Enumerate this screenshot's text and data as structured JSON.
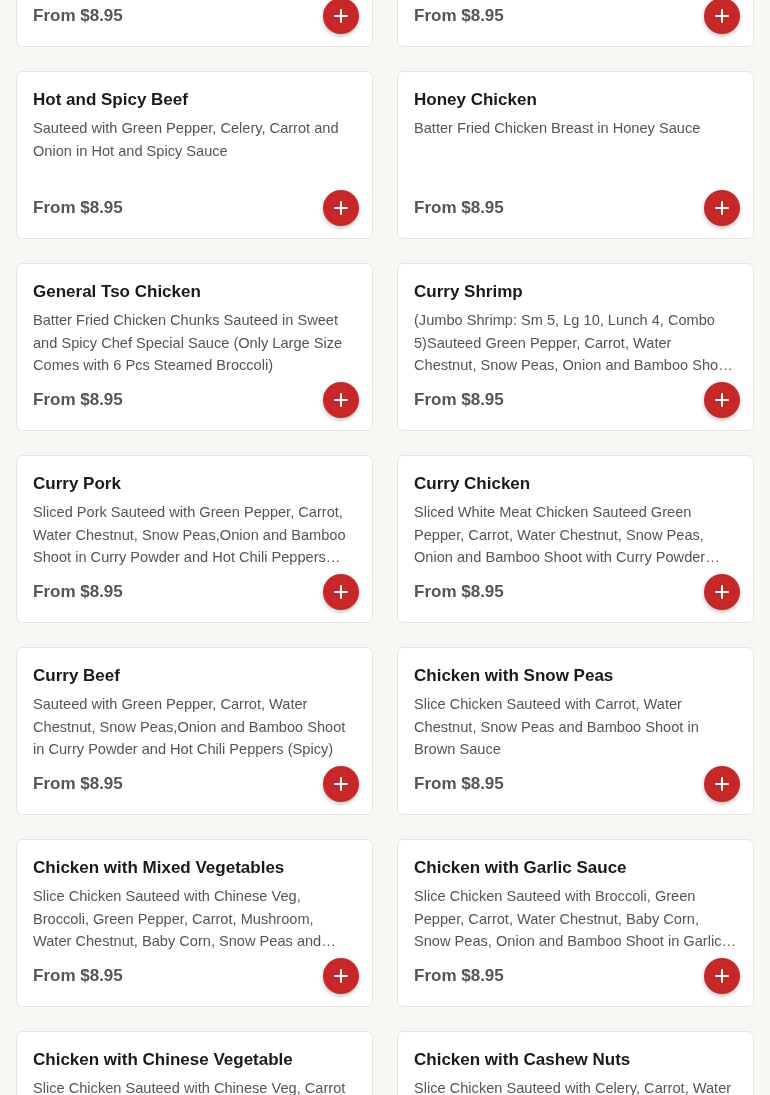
{
  "menu_items": [
    {
      "kind": "partial",
      "price": "From $8.95"
    },
    {
      "kind": "partial",
      "price": "From $8.95"
    },
    {
      "kind": "full",
      "name": "Hot and Spicy Beef",
      "description": "Sauteed with Green Pepper, Celery, Carrot and Onion in Hot and Spicy Sauce",
      "price": "From $8.95"
    },
    {
      "kind": "full",
      "name": "Honey Chicken",
      "description": "Batter Fried Chicken Breast in Honey Sauce",
      "price": "From $8.95"
    },
    {
      "kind": "full",
      "name": "General Tso Chicken",
      "description": "Batter Fried Chicken Chunks Sauteed in Sweet and Spicy Chef Special Sauce (Only Large Size Comes with 6 Pcs Steamed Broccoli)",
      "price": "From $8.95"
    },
    {
      "kind": "full",
      "name": "Curry Shrimp",
      "description": "(Jumbo Shrimp: Sm 5, Lg 10, Lunch 4, Combo 5)Sauteed Green Pepper, Carrot, Water Chestnut, Snow Peas, Onion and Bamboo Sho…",
      "price": "From $8.95"
    },
    {
      "kind": "full",
      "name": "Curry Pork",
      "description": "Sliced Pork Sauteed with Green Pepper, Carrot, Water Chestnut, Snow Peas,Onion and Bamboo Shoot in Curry Powder and Hot Chili Peppers…",
      "price": "From $8.95"
    },
    {
      "kind": "full",
      "name": "Curry Chicken",
      "description": "Sliced White Meat Chicken Sauteed Green Pepper, Carrot, Water Chestnut, Snow Peas, Onion and Bamboo Shoot with Curry Powder…",
      "price": "From $8.95"
    },
    {
      "kind": "full",
      "name": "Curry Beef",
      "description": "Sauteed with Green Pepper, Carrot, Water Chestnut, Snow Peas,Onion and Bamboo Shoot in Curry Powder and Hot Chili Peppers (Spicy)",
      "price": "From $8.95"
    },
    {
      "kind": "full",
      "name": "Chicken with Snow Peas",
      "description": "Slice Chicken Sauteed with Carrot, Water Chestnut, Snow Peas and Bamboo Shoot in Brown Sauce",
      "price": "From $8.95"
    },
    {
      "kind": "full",
      "name": "Chicken with Mixed Vegetables",
      "description": "Slice Chicken Sauteed with Chinese Veg, Broccoli, Green Pepper, Carrot, Mushroom, Water Chestnut, Baby Corn, Snow Peas and…",
      "price": "From $8.95"
    },
    {
      "kind": "full",
      "name": "Chicken with Garlic Sauce",
      "description": "Slice Chicken Sauteed with Broccoli, Green Pepper, Carrot, Water Chestnut, Baby Corn, Snow Peas, Onion and Bamboo Shoot in Garlic…",
      "price": "From $8.95"
    },
    {
      "kind": "cut",
      "name": "Chicken with Chinese Vegetable",
      "description": "Slice Chicken Sauteed with Chinese Veg, Carrot"
    },
    {
      "kind": "cut",
      "name": "Chicken with Cashew Nuts",
      "description": "Slice Chicken Sauteed with Celery, Carrot, Water"
    }
  ]
}
